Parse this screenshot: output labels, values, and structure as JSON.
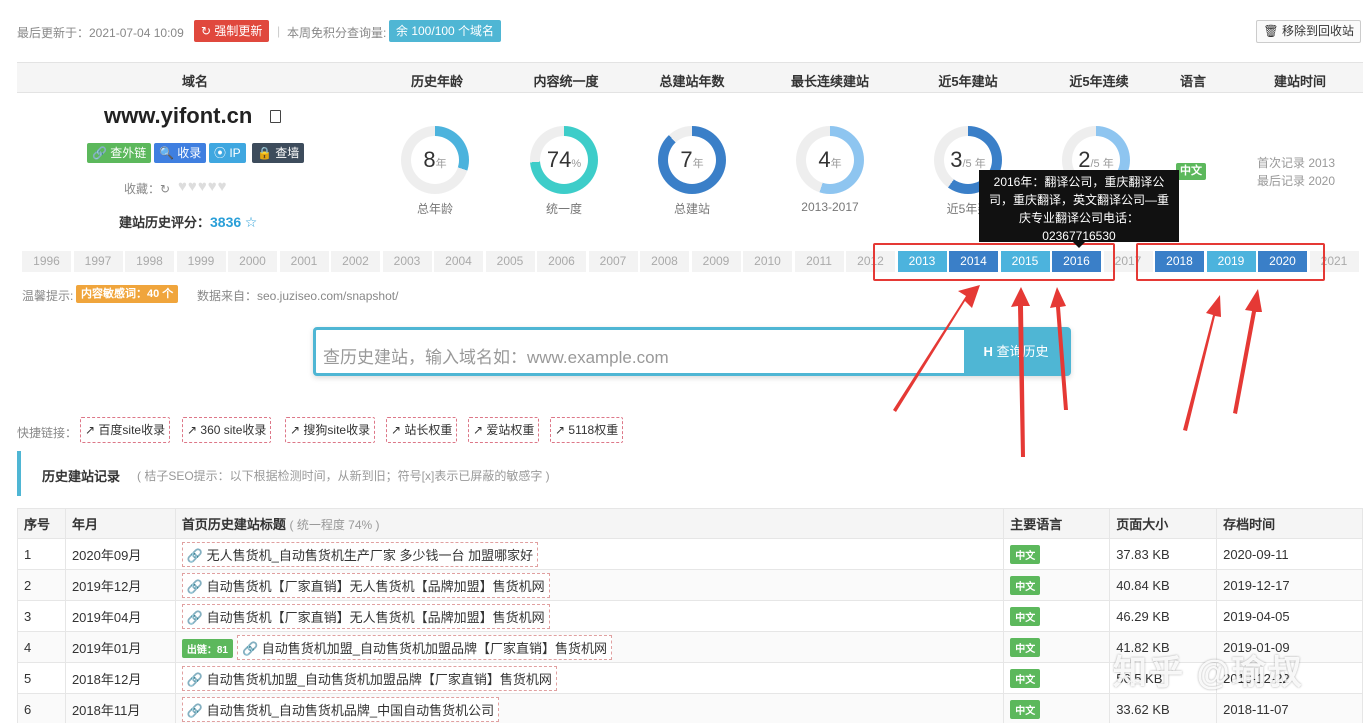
{
  "topbar": {
    "updated": "最后更新于：2021-07-04 10:09",
    "force_update": "强制更新",
    "separator": "|",
    "quota_label": "本周免积分查询量:",
    "quota_badge": "余 100/100 个域名",
    "recycle": "移除到回收站"
  },
  "table_headers": [
    "域名",
    "历史年龄",
    "内容统一度",
    "总建站年数",
    "最长连续建站",
    "近5年建站",
    "近5年连续",
    "语言",
    "建站时间"
  ],
  "domain": {
    "name": "www.yifont.cn",
    "tags": [
      "查外链",
      "收录",
      "IP",
      "查墙"
    ],
    "favorite_label": "收藏：",
    "hearts": "♥♥♥♥♥",
    "score_label": "建站历史评分：",
    "score": "3836",
    "star": "☆"
  },
  "metrics": [
    {
      "value": "8",
      "unit": "年",
      "label": "总年龄",
      "fraction": 0.3
    },
    {
      "value": "74",
      "unit": "%",
      "label": "统一度",
      "fraction": 0.74
    },
    {
      "value": "7",
      "unit": "年",
      "label": "总建站",
      "fraction": 0.88
    },
    {
      "value": "4",
      "unit": "年",
      "label": "2013-2017",
      "fraction": 0.55
    },
    {
      "value": "3",
      "unit": "/5 年",
      "label": "近5年建",
      "fraction": 0.6
    },
    {
      "value": "2",
      "unit": "/5 年",
      "label": "",
      "fraction": 0.4
    }
  ],
  "language_badge": "中文",
  "record": {
    "first": "首次记录 2013",
    "last": "最后记录 2020"
  },
  "tooltip": "2016年：翻译公司，重庆翻译公司，重庆翻译，英文翻译公司—重庆专业翻译公司电话：02367716530",
  "timeline": {
    "years": [
      "1996",
      "1997",
      "1998",
      "1999",
      "2000",
      "2001",
      "2002",
      "2003",
      "2004",
      "2005",
      "2006",
      "2007",
      "2008",
      "2009",
      "2010",
      "2011",
      "2012",
      "2013",
      "2014",
      "2015",
      "2016",
      "2017",
      "2018",
      "2019",
      "2020",
      "2021"
    ],
    "active": [
      "2013",
      "2014",
      "2015",
      "2016",
      "2018",
      "2019",
      "2020"
    ]
  },
  "tips": {
    "label": "温馨提示:",
    "badge": "内容敏感词：40 个",
    "source": "数据来自：seo.juziseo.com/snapshot/"
  },
  "search": {
    "placeholder": "查历史建站，输入域名如：www.example.com",
    "button": "查询历史"
  },
  "quick_links": {
    "label": "快捷链接：",
    "items": [
      "百度site收录",
      "360 site收录",
      "搜狗site收录",
      "站长权重",
      "爱站权重",
      "5118权重"
    ]
  },
  "section": {
    "title": "历史建站记录",
    "desc": "( 桔子SEO提示：以下根据检测时间，从新到旧；符号[x]表示已屏蔽的敏感字 )"
  },
  "history_table": {
    "headers": [
      "序号",
      "年月",
      "首页历史建站标题",
      "主要语言",
      "页面大小",
      "存档时间"
    ],
    "title_note": "( 统一程度 74% )",
    "rows": [
      {
        "no": "1",
        "date": "2020年09月",
        "title": "无人售货机_自动售货机生产厂家 多少钱一台 加盟哪家好",
        "badge": "",
        "lang": "中文",
        "size": "37.83 KB",
        "archived": "2020-09-11"
      },
      {
        "no": "2",
        "date": "2019年12月",
        "title": "自动售货机【厂家直销】无人售货机【品牌加盟】售货机网",
        "badge": "",
        "lang": "中文",
        "size": "40.84 KB",
        "archived": "2019-12-17"
      },
      {
        "no": "3",
        "date": "2019年04月",
        "title": "自动售货机【厂家直销】无人售货机【品牌加盟】售货机网",
        "badge": "",
        "lang": "中文",
        "size": "46.29 KB",
        "archived": "2019-04-05"
      },
      {
        "no": "4",
        "date": "2019年01月",
        "title": "自动售货机加盟_自动售货机加盟品牌【厂家直销】售货机网",
        "badge": "出链：81",
        "lang": "中文",
        "size": "41.82 KB",
        "archived": "2019-01-09"
      },
      {
        "no": "5",
        "date": "2018年12月",
        "title": "自动售货机加盟_自动售货机加盟品牌【厂家直销】售货机网",
        "badge": "",
        "lang": "中文",
        "size": "56.5 KB",
        "archived": "2018-12-22"
      },
      {
        "no": "6",
        "date": "2018年11月",
        "title": "自动售货机_自动售货机品牌_中国自动售货机公司",
        "badge": "",
        "lang": "中文",
        "size": "33.62 KB",
        "archived": "2018-11-07"
      }
    ]
  },
  "watermark": "知乎 @瑜叔",
  "colors": {
    "accent": "#4fb6d4",
    "red": "#e53935",
    "green": "#5cb85c",
    "orange": "#f0a53c",
    "dark_blue": "#3a7fc8"
  }
}
